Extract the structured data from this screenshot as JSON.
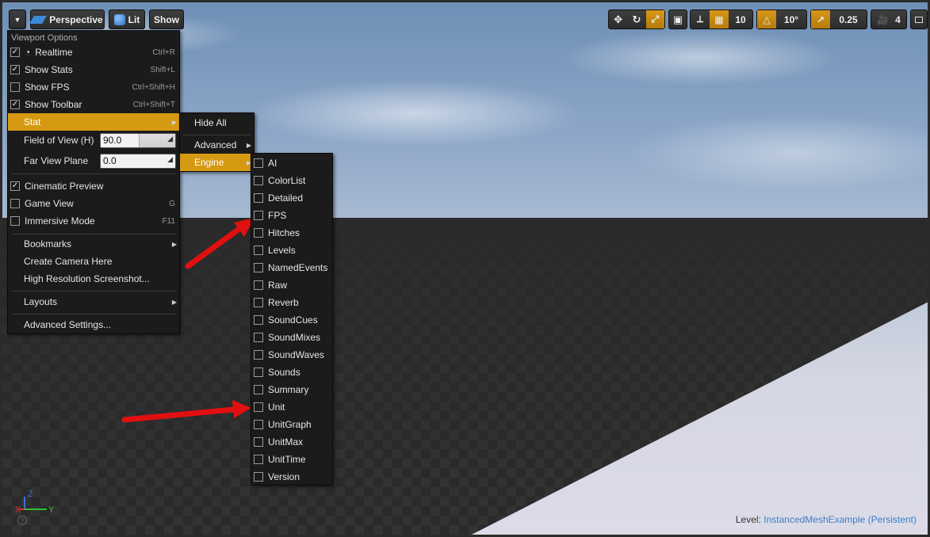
{
  "toolbar": {
    "perspective_label": "Perspective",
    "lit_label": "Lit",
    "show_label": "Show",
    "grid_snap_value": "10",
    "rotation_snap_value": "10°",
    "scale_snap_value": "0.25",
    "camera_speed_value": "4"
  },
  "viewport_menu": {
    "header": "Viewport Options",
    "realtime": {
      "label": "Realtime",
      "shortcut": "Ctrl+R",
      "checked": true
    },
    "show_stats": {
      "label": "Show Stats",
      "shortcut": "Shift+L",
      "checked": true
    },
    "show_fps": {
      "label": "Show FPS",
      "shortcut": "Ctrl+Shift+H",
      "checked": false
    },
    "show_toolbar": {
      "label": "Show Toolbar",
      "shortcut": "Ctrl+Shift+T",
      "checked": true
    },
    "stat": {
      "label": "Stat"
    },
    "fov": {
      "label": "Field of View (H)",
      "value": "90.0"
    },
    "far_plane": {
      "label": "Far View Plane",
      "value": "0.0"
    },
    "cinematic_preview": {
      "label": "Cinematic Preview",
      "checked": true
    },
    "game_view": {
      "label": "Game View",
      "shortcut": "G",
      "checked": false
    },
    "immersive_mode": {
      "label": "Immersive Mode",
      "shortcut": "F11",
      "checked": false
    },
    "bookmarks": {
      "label": "Bookmarks"
    },
    "create_camera": {
      "label": "Create Camera Here"
    },
    "high_res_screenshot": {
      "label": "High Resolution Screenshot..."
    },
    "layouts": {
      "label": "Layouts"
    },
    "advanced_settings": {
      "label": "Advanced Settings..."
    }
  },
  "stat_menu": {
    "hide_all": "Hide All",
    "advanced": "Advanced",
    "engine": "Engine"
  },
  "engine_menu": {
    "items": [
      "AI",
      "ColorList",
      "Detailed",
      "FPS",
      "Hitches",
      "Levels",
      "NamedEvents",
      "Raw",
      "Reverb",
      "SoundCues",
      "SoundMixes",
      "SoundWaves",
      "Sounds",
      "Summary",
      "Unit",
      "UnitGraph",
      "UnitMax",
      "UnitTime",
      "Version"
    ]
  },
  "level_info": {
    "label": "Level:",
    "value": "InstancedMeshExample (Persistent)"
  },
  "axis_labels": {
    "x": "X",
    "y": "Y",
    "z": "Z"
  },
  "colors": {
    "highlight": "#d69a12",
    "menu_bg": "#1b1b1b",
    "arrow_red": "#e01010",
    "level_name": "#3d7dc2"
  }
}
